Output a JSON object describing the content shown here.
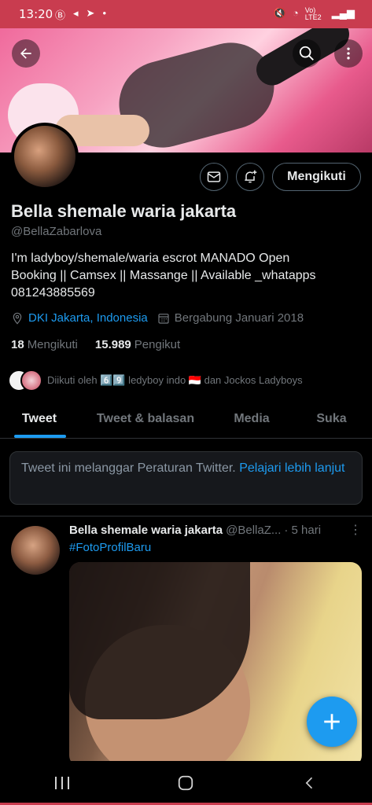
{
  "status_bar": {
    "time": "13:20",
    "left_icons": [
      "b-circle-icon",
      "send-icon",
      "navigation-icon",
      "dot-icon"
    ],
    "right_icons": [
      "mute-icon",
      "wifi-icon",
      "volte-icon",
      "signal-icon",
      "signal-icon"
    ],
    "network_label": "Vo) LTE2"
  },
  "profile": {
    "display_name": "Bella shemale waria jakarta",
    "handle": "@BellaZabarlova",
    "bio_lines": [
      "I'm ladyboy/shemale/waria escrot MANADO Open",
      "Booking || Camsex || Massange || Available  _whatapps",
      "081243885569"
    ],
    "location": "DKI Jakarta, Indonesia",
    "joined": "Bergabung Januari 2018",
    "following_count": "18",
    "following_label": "Mengikuti",
    "followers_count": "15.989",
    "followers_label": "Pengikut",
    "followed_by_text": "Diikuti oleh 6️⃣9️⃣ ledyboy indo 🇮🇩 dan Jockos Ladyboys",
    "follow_button_label": "Mengikuti"
  },
  "tabs": [
    {
      "label": "Tweet",
      "active": true
    },
    {
      "label": "Tweet & balasan",
      "active": false
    },
    {
      "label": "Media",
      "active": false
    },
    {
      "label": "Suka",
      "active": false
    }
  ],
  "notice": {
    "text": "Tweet ini melanggar Peraturan Twitter.",
    "link": "Pelajari lebih lanjut"
  },
  "tweet": {
    "name": "Bella shemale waria jakarta",
    "handle": "@BellaZ...",
    "time": "· 5 hari",
    "hashtag": "#FotoProfilBaru"
  },
  "colors": {
    "accent": "#1d9bf0",
    "status_bar": "#c93c4f",
    "background": "#000000",
    "muted_text": "#71767b"
  }
}
